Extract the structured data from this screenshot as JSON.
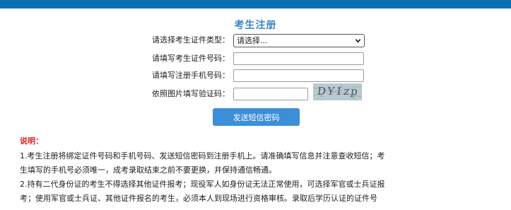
{
  "header": {
    "title": "考生注册"
  },
  "form": {
    "id_type": {
      "label": "请选择考生证件类型：",
      "selected": "请选择..."
    },
    "id_number": {
      "label": "请填写考生证件号码：",
      "value": ""
    },
    "phone": {
      "label": "请填写注册手机号码：",
      "value": ""
    },
    "captcha": {
      "label": "依照图片填写验证码：",
      "value": "",
      "image_text": "DY1zp"
    },
    "send_button_label": "发送短信密码"
  },
  "notes": {
    "title": "说明：",
    "lines": [
      "1.考生注册将绑定证件号码和手机号码、发送短信密码到注册手机上。请准确填写信息并注意查收短信；考",
      "生填写的手机号必须唯一，成考录取结束之前不要更换，并保持通信畅通。",
      "2.持有二代身份证的考生不得选择其他证件报考；现役军人如身份证无法正常使用，可选择军官或士兵证报",
      "考；使用军官或士兵证、其他证件报名的考生，必须本人到现场进行资格审核。录取后学历认证的证件号"
    ]
  },
  "colors": {
    "top_bar": "#0a6fb5",
    "title": "#3a84c7",
    "button": "#3d8ed8",
    "notes_title": "#e02121"
  }
}
